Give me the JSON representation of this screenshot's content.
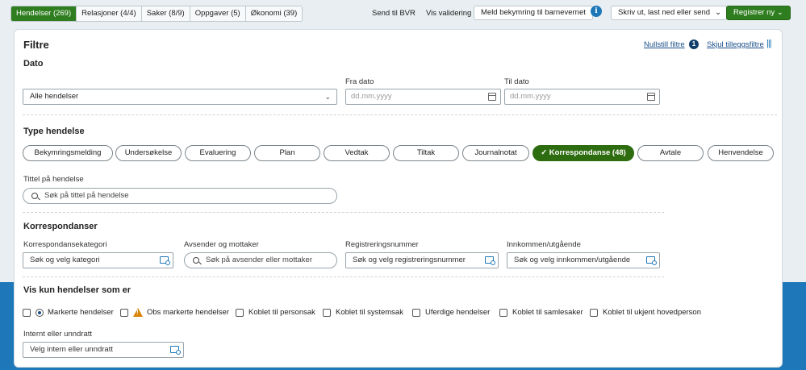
{
  "tabs": [
    {
      "label": "Hendelser (269)"
    },
    {
      "label": "Relasjoner (4/4)"
    },
    {
      "label": "Saker (8/9)"
    },
    {
      "label": "Oppgaver (5)"
    },
    {
      "label": "Økonomi (39)"
    }
  ],
  "toolbar": {
    "send_bvr": "Send til BVR",
    "show_validation": "Vis validering",
    "report_button": "Meld bekymring til barnevernet",
    "info_glyph": "i",
    "print_menu": "Skriv ut, last ned eller send",
    "register_button": "Registrer ny"
  },
  "filters": {
    "title": "Filtre",
    "reset_link": "Nullstill filtre",
    "active_count": "1",
    "hide_extra_link": "Skjul tilleggsfiltre"
  },
  "date": {
    "title": "Dato",
    "select_value": "Alle hendelser",
    "from_label": "Fra dato",
    "from_placeholder": "dd.mm.yyyy",
    "to_label": "Til dato",
    "to_placeholder": "dd.mm.yyyy"
  },
  "type": {
    "title": "Type hendelse",
    "chips": [
      "Bekymringsmelding",
      "Undersøkelse",
      "Evaluering",
      "Plan",
      "Vedtak",
      "Tiltak",
      "Journalnotat",
      "✓  Korrespondanse (48)",
      "Avtale",
      "Henvendelse"
    ],
    "title_label": "Tittel på hendelse",
    "title_placeholder": "Søk på tittel på hendelse"
  },
  "correspondence": {
    "title": "Korrespondanser",
    "category_label": "Korrespondansekategori",
    "category_value": "Søk og velg kategori",
    "sender_label": "Avsender og mottaker",
    "sender_value": "Søk på avsender eller mottaker",
    "regnum_label": "Registreringsnummer",
    "regnum_value": "Søk og velg registreringsnummer",
    "inout_label": "Innkommen/utgående",
    "inout_value": "Søk og velg innkommen/utgående"
  },
  "show_only": {
    "title": "Vis kun hendelser som er",
    "options": [
      "Markerte hendelser",
      "Obs markerte hendelser",
      "Koblet til personsak",
      "Koblet til systemsak",
      "Uferdige hendelser",
      "Koblet til samlesaker",
      "Koblet til ukjent hovedperson"
    ],
    "internal_label": "Internt eller unndratt",
    "internal_value": "Velg intern eller unndratt"
  }
}
